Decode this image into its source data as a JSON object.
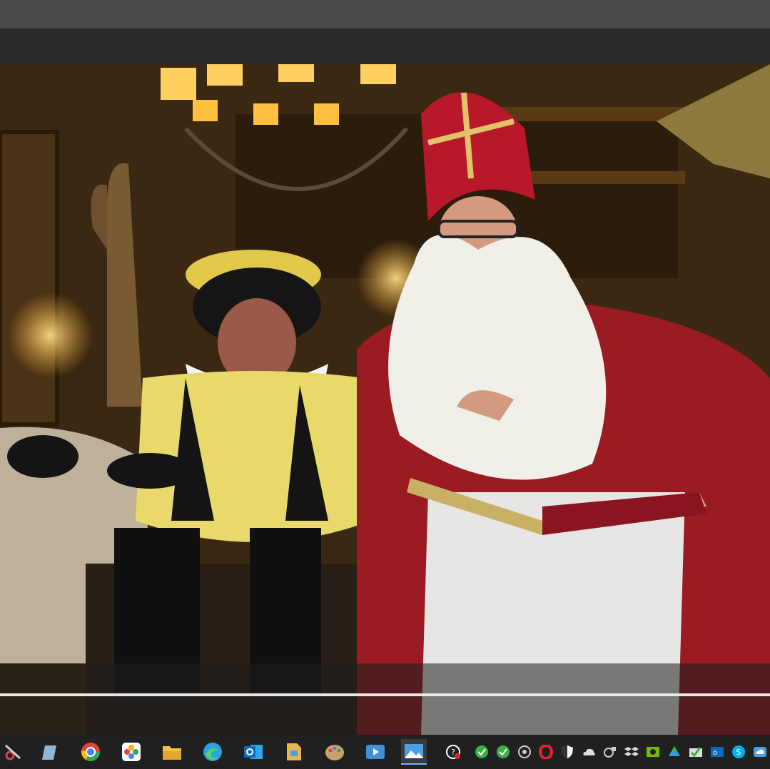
{
  "window": {
    "title": ""
  },
  "taskbar": {
    "apps": [
      {
        "icon": "snipping-tool-icon",
        "color": "#d64545"
      },
      {
        "icon": "notepad-icon",
        "color": "#8fb8d8"
      },
      {
        "icon": "chrome-icon",
        "color": "#e94335"
      },
      {
        "icon": "photos-icon",
        "color": "#f4b400"
      },
      {
        "icon": "file-explorer-icon",
        "color": "#f5c242"
      },
      {
        "icon": "edge-icon",
        "color": "#2ea1e0"
      },
      {
        "icon": "outlook-icon",
        "color": "#0f6cbd"
      },
      {
        "icon": "folder-icon",
        "color": "#e8b64a"
      },
      {
        "icon": "paint-icon",
        "color": "#c9a36a"
      },
      {
        "icon": "media-player-icon",
        "color": "#3d8fd6"
      },
      {
        "icon": "photo-viewer-icon",
        "color": "#4aa3df"
      }
    ],
    "tray": [
      {
        "icon": "help-icon",
        "color": "#ffffff"
      },
      {
        "icon": "sync-green-icon",
        "color": "#3cb043"
      },
      {
        "icon": "sync-green-icon-2",
        "color": "#3cb043"
      },
      {
        "icon": "network-icon",
        "color": "#cccccc"
      },
      {
        "icon": "opera-icon",
        "color": "#e0262b"
      },
      {
        "icon": "security-shield-icon",
        "color": "#ffffff"
      },
      {
        "icon": "onedrive-icon",
        "color": "#dddddd"
      },
      {
        "icon": "vpn-icon",
        "color": "#cccccc"
      },
      {
        "icon": "dropbox-icon",
        "color": "#dddddd"
      },
      {
        "icon": "nvidia-icon",
        "color": "#76b900"
      },
      {
        "icon": "drive-icon",
        "color": "#2ea1e0"
      },
      {
        "icon": "checkmark-app-icon",
        "color": "#3cb043"
      },
      {
        "icon": "outlook-tray-icon",
        "color": "#0f6cbd"
      },
      {
        "icon": "skype-icon",
        "color": "#00aff0"
      },
      {
        "icon": "cloud-sync-icon",
        "color": "#4aa3df"
      }
    ]
  }
}
